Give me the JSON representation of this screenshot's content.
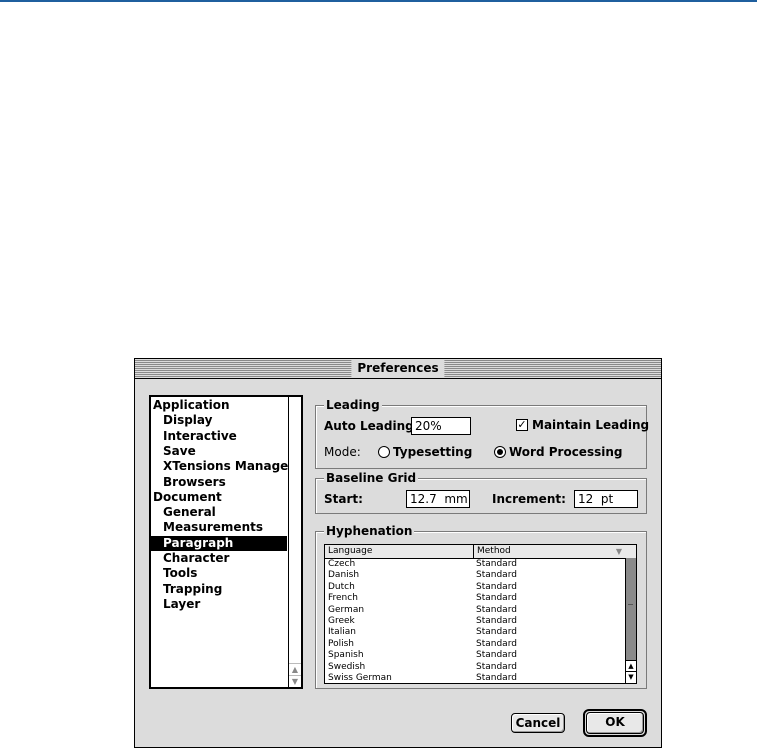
{
  "dialog": {
    "title": "Preferences",
    "categories": [
      {
        "label": "Application",
        "indent": false,
        "selected": false
      },
      {
        "label": "Display",
        "indent": true,
        "selected": false
      },
      {
        "label": "Interactive",
        "indent": true,
        "selected": false
      },
      {
        "label": "Save",
        "indent": true,
        "selected": false
      },
      {
        "label": "XTensions Manager",
        "indent": true,
        "selected": false
      },
      {
        "label": "Browsers",
        "indent": true,
        "selected": false
      },
      {
        "label": "Document",
        "indent": false,
        "selected": false
      },
      {
        "label": "General",
        "indent": true,
        "selected": false
      },
      {
        "label": "Measurements",
        "indent": true,
        "selected": false
      },
      {
        "label": "Paragraph",
        "indent": true,
        "selected": true
      },
      {
        "label": "Character",
        "indent": true,
        "selected": false
      },
      {
        "label": "Tools",
        "indent": true,
        "selected": false
      },
      {
        "label": "Trapping",
        "indent": true,
        "selected": false
      },
      {
        "label": "Layer",
        "indent": true,
        "selected": false
      }
    ],
    "leading": {
      "legend": "Leading",
      "auto_label": "Auto Leading:",
      "auto_value": "20%",
      "maintain_label": "Maintain Leading",
      "maintain_checked": true,
      "mode_label": "Mode:",
      "typesetting_label": "Typesetting",
      "word_processing_label": "Word Processing",
      "selected_mode": "word_processing"
    },
    "baseline": {
      "legend": "Baseline Grid",
      "start_label": "Start:",
      "start_value": "12.7  mm",
      "increment_label": "Increment:",
      "increment_value": "12  pt"
    },
    "hyphenation": {
      "legend": "Hyphenation",
      "columns": [
        "Language",
        "Method"
      ],
      "rows": [
        [
          "Czech",
          "Standard"
        ],
        [
          "Danish",
          "Standard"
        ],
        [
          "Dutch",
          "Standard"
        ],
        [
          "French",
          "Standard"
        ],
        [
          "German",
          "Standard"
        ],
        [
          "Greek",
          "Standard"
        ],
        [
          "Italian",
          "Standard"
        ],
        [
          "Polish",
          "Standard"
        ],
        [
          "Spanish",
          "Standard"
        ],
        [
          "Swedish",
          "Standard"
        ],
        [
          "Swiss German",
          "Standard"
        ]
      ]
    },
    "buttons": {
      "cancel": "Cancel",
      "ok": "OK"
    }
  }
}
